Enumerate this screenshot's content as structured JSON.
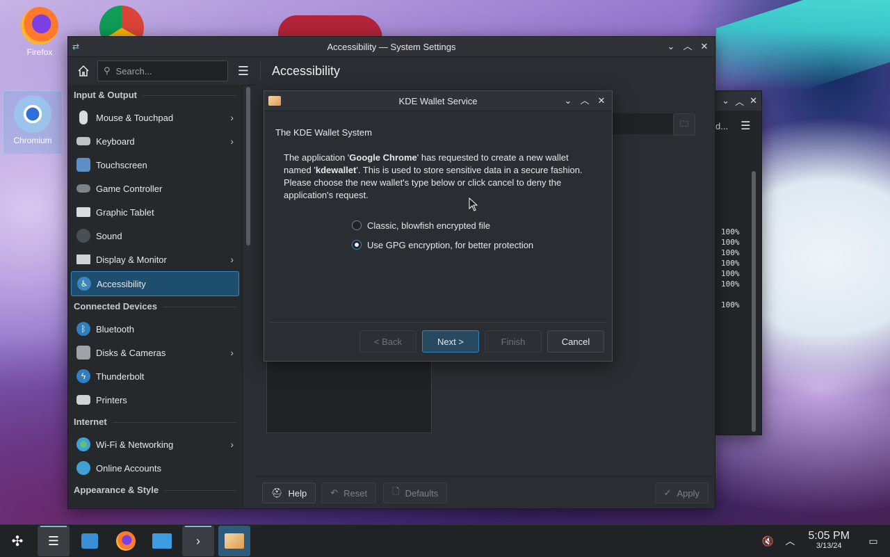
{
  "desktop": {
    "icons": [
      {
        "label": "Firefox"
      },
      {
        "label": "Chromium"
      }
    ]
  },
  "settings": {
    "window_title": "Accessibility — System Settings",
    "search_placeholder": "Search...",
    "page_title": "Accessibility",
    "categories": [
      {
        "label": "Input & Output",
        "items": [
          {
            "label": "Mouse & Touchpad",
            "chevron": true,
            "icon": "mouse-icon",
            "color": "#d9dcdf"
          },
          {
            "label": "Keyboard",
            "chevron": true,
            "icon": "keyboard-icon",
            "color": "#bfc3c7"
          },
          {
            "label": "Touchscreen",
            "chevron": false,
            "icon": "touchscreen-icon",
            "color": "#5c8fc4"
          },
          {
            "label": "Game Controller",
            "chevron": false,
            "icon": "gamepad-icon",
            "color": "#7e8388"
          },
          {
            "label": "Graphic Tablet",
            "chevron": false,
            "icon": "tablet-icon",
            "color": "#d9dcdf"
          },
          {
            "label": "Sound",
            "chevron": false,
            "icon": "speaker-icon",
            "color": "#4a4f54"
          },
          {
            "label": "Display & Monitor",
            "chevron": true,
            "icon": "monitor-icon",
            "color": "#cfd3d6"
          },
          {
            "label": "Accessibility",
            "chevron": false,
            "icon": "accessibility-icon",
            "color": "#3a86c0",
            "active": true
          }
        ]
      },
      {
        "label": "Connected Devices",
        "items": [
          {
            "label": "Bluetooth",
            "chevron": false,
            "icon": "bluetooth-icon",
            "color": "#2f7fc1"
          },
          {
            "label": "Disks & Cameras",
            "chevron": true,
            "icon": "disk-icon",
            "color": "#9ea3a7"
          },
          {
            "label": "Thunderbolt",
            "chevron": false,
            "icon": "thunderbolt-icon",
            "color": "#2f7fc1"
          },
          {
            "label": "Printers",
            "chevron": false,
            "icon": "printer-icon",
            "color": "#cfd3d6"
          }
        ]
      },
      {
        "label": "Internet",
        "items": [
          {
            "label": "Wi-Fi & Networking",
            "chevron": true,
            "icon": "globe-icon",
            "color": "#3fa1d6"
          },
          {
            "label": "Online Accounts",
            "chevron": false,
            "icon": "online-accounts-icon",
            "color": "#3fa1d6"
          }
        ]
      },
      {
        "label": "Appearance & Style",
        "items": []
      }
    ],
    "footer": {
      "help": "Help",
      "reset": "Reset",
      "defaults": "Defaults",
      "apply": "Apply"
    }
  },
  "konsole": {
    "title_fragment": "d...",
    "lines": [
      "100%",
      "100%",
      "100%",
      "100%",
      "100%",
      "100%",
      "",
      "100%"
    ]
  },
  "wallet": {
    "title": "KDE Wallet Service",
    "heading": "The KDE Wallet System",
    "message_pre": "The application '",
    "app_name": "Google Chrome",
    "message_mid": "' has requested to create a new wallet named '",
    "wallet_name": "kdewallet",
    "message_post": "'. This is used to store sensitive data in a secure fashion. Please choose the new wallet's type below or click cancel to deny the application's request.",
    "options": [
      {
        "label": "Classic, blowfish encrypted file",
        "selected": false
      },
      {
        "label": "Use GPG encryption, for better protection",
        "selected": true
      }
    ],
    "buttons": {
      "back": "< Back",
      "next": "Next >",
      "finish": "Finish",
      "cancel": "Cancel"
    }
  },
  "taskbar": {
    "time": "5:05 PM",
    "date": "3/13/24"
  },
  "colors": {
    "accent": "#3a86c0",
    "window_bg": "#2a2e32",
    "sidebar_bg": "#25292c"
  }
}
